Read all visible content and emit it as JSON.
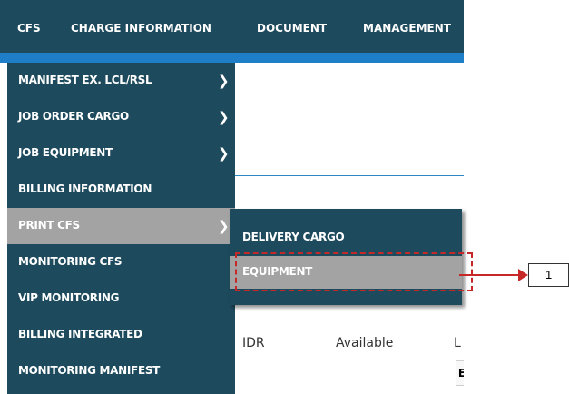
{
  "topnav": {
    "items": [
      "CFS",
      "CHARGE INFORMATION",
      "DOCUMENT",
      "MANAGEMENT"
    ]
  },
  "menu": {
    "items": [
      {
        "label": "MANIFEST EX. LCL/RSL",
        "has_submenu": true
      },
      {
        "label": "JOB ORDER CARGO",
        "has_submenu": true
      },
      {
        "label": "JOB EQUIPMENT",
        "has_submenu": true
      },
      {
        "label": "BILLING INFORMATION",
        "has_submenu": false
      },
      {
        "label": "PRINT CFS",
        "has_submenu": true,
        "active": true
      },
      {
        "label": "MONITORING CFS",
        "has_submenu": false
      },
      {
        "label": "VIP MONITORING",
        "has_submenu": false
      },
      {
        "label": "BILLING INTEGRATED",
        "has_submenu": false
      },
      {
        "label": "MONITORING MANIFEST",
        "has_submenu": false
      }
    ]
  },
  "submenu": {
    "items": [
      {
        "label": "DELIVERY CARGO"
      },
      {
        "label": "EQUIPMENT",
        "active": true
      }
    ]
  },
  "content": {
    "currency": "IDR",
    "status": "Available",
    "col_label": "L",
    "box_text": "E"
  },
  "annotation": {
    "callout_number": "1"
  },
  "colors": {
    "nav_bg": "#1d4a5d",
    "active_bg": "#a3a3a3",
    "accent_blue": "#1e7fc8",
    "annotation_red": "#c62828"
  },
  "icons": {
    "submenu_indicator": "chevron-right-icon"
  }
}
